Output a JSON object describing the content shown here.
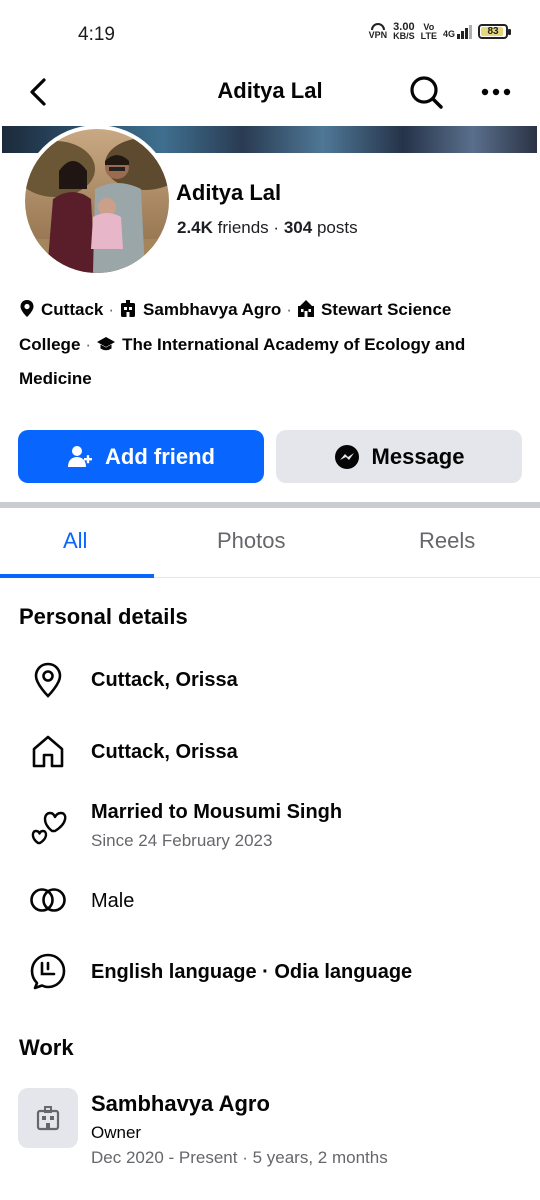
{
  "status_bar": {
    "time": "4:19",
    "vpn": "VPN",
    "speed_value": "3.00",
    "speed_unit": "KB/S",
    "volte_top": "Vo",
    "volte_bottom": "LTE",
    "network": "4G",
    "battery": "83",
    "battery_level_percent": 83
  },
  "header": {
    "title": "Aditya Lal",
    "back_icon": "chevron-left-icon",
    "search_icon": "search-icon",
    "more_icon": "more-horizontal-icon"
  },
  "profile": {
    "name": "Aditya Lal",
    "friends_count": "2.4K",
    "friends_label": "friends",
    "dot": "·",
    "posts_count": "304",
    "posts_label": "posts"
  },
  "intro": {
    "location": "Cuttack",
    "workplace": "Sambhavya Agro",
    "college": "Stewart Science College",
    "academy": "The International Academy of Ecology and Medicine",
    "separator": "·"
  },
  "actions": {
    "add_friend": "Add friend",
    "message": "Message"
  },
  "tabs": [
    {
      "label": "All",
      "active": true
    },
    {
      "label": "Photos",
      "active": false
    },
    {
      "label": "Reels",
      "active": false
    }
  ],
  "personal_details": {
    "title": "Personal details",
    "current_city": "Cuttack, Orissa",
    "hometown": "Cuttack, Orissa",
    "relationship": "Married to Mousumi Singh",
    "relationship_since": "Since 24 February 2023",
    "gender": "Male",
    "languages": "English language · Odia language"
  },
  "work": {
    "title": "Work",
    "company": "Sambhavya Agro",
    "role": "Owner",
    "period": "Dec 2020 - Present · 5 years, 2 months"
  },
  "colors": {
    "accent": "#0866ff",
    "secondary_button": "#e4e6eb",
    "muted_text": "#65676b"
  }
}
